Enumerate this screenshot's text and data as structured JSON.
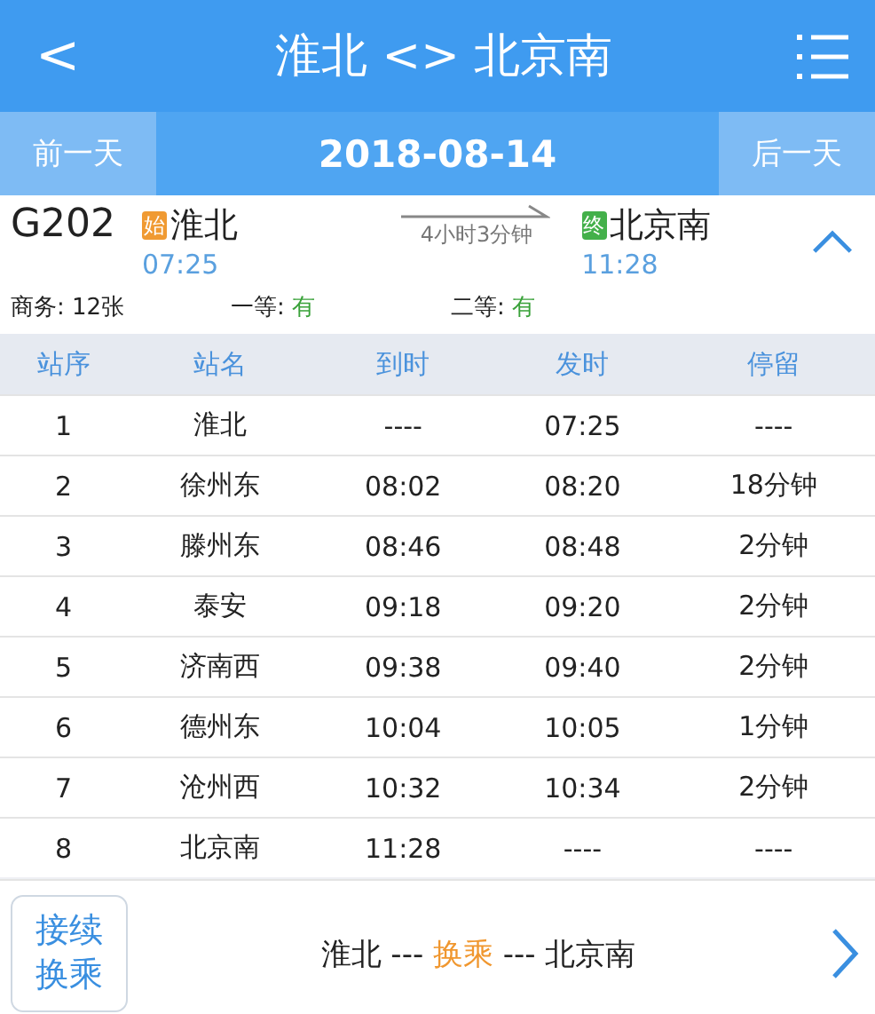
{
  "header": {
    "back": "<",
    "title": "淮北 <> 北京南"
  },
  "date_bar": {
    "prev": "前一天",
    "date": "2018-08-14",
    "next": "后一天"
  },
  "train": {
    "number": "G202",
    "from": {
      "badge": "始",
      "station": "淮北",
      "time": "07:25"
    },
    "duration": "4小时3分钟",
    "to": {
      "badge": "终",
      "station": "北京南",
      "time": "11:28"
    },
    "expanded": true,
    "seats": [
      {
        "label": "商务:",
        "value": "12张",
        "available": false
      },
      {
        "label": "一等:",
        "value": "有",
        "available": true
      },
      {
        "label": "二等:",
        "value": "有",
        "available": true
      }
    ]
  },
  "table": {
    "columns": [
      "站序",
      "站名",
      "到时",
      "发时",
      "停留"
    ],
    "rows": [
      [
        "1",
        "淮北",
        "----",
        "07:25",
        "----"
      ],
      [
        "2",
        "徐州东",
        "08:02",
        "08:20",
        "18分钟"
      ],
      [
        "3",
        "滕州东",
        "08:46",
        "08:48",
        "2分钟"
      ],
      [
        "4",
        "泰安",
        "09:18",
        "09:20",
        "2分钟"
      ],
      [
        "5",
        "济南西",
        "09:38",
        "09:40",
        "2分钟"
      ],
      [
        "6",
        "德州东",
        "10:04",
        "10:05",
        "1分钟"
      ],
      [
        "7",
        "沧州西",
        "10:32",
        "10:34",
        "2分钟"
      ],
      [
        "8",
        "北京南",
        "11:28",
        "----",
        "----"
      ]
    ]
  },
  "transfer": {
    "button": "接续换乘",
    "from": "淮北 ---",
    "via": "换乘",
    "to": "--- 北京南"
  }
}
